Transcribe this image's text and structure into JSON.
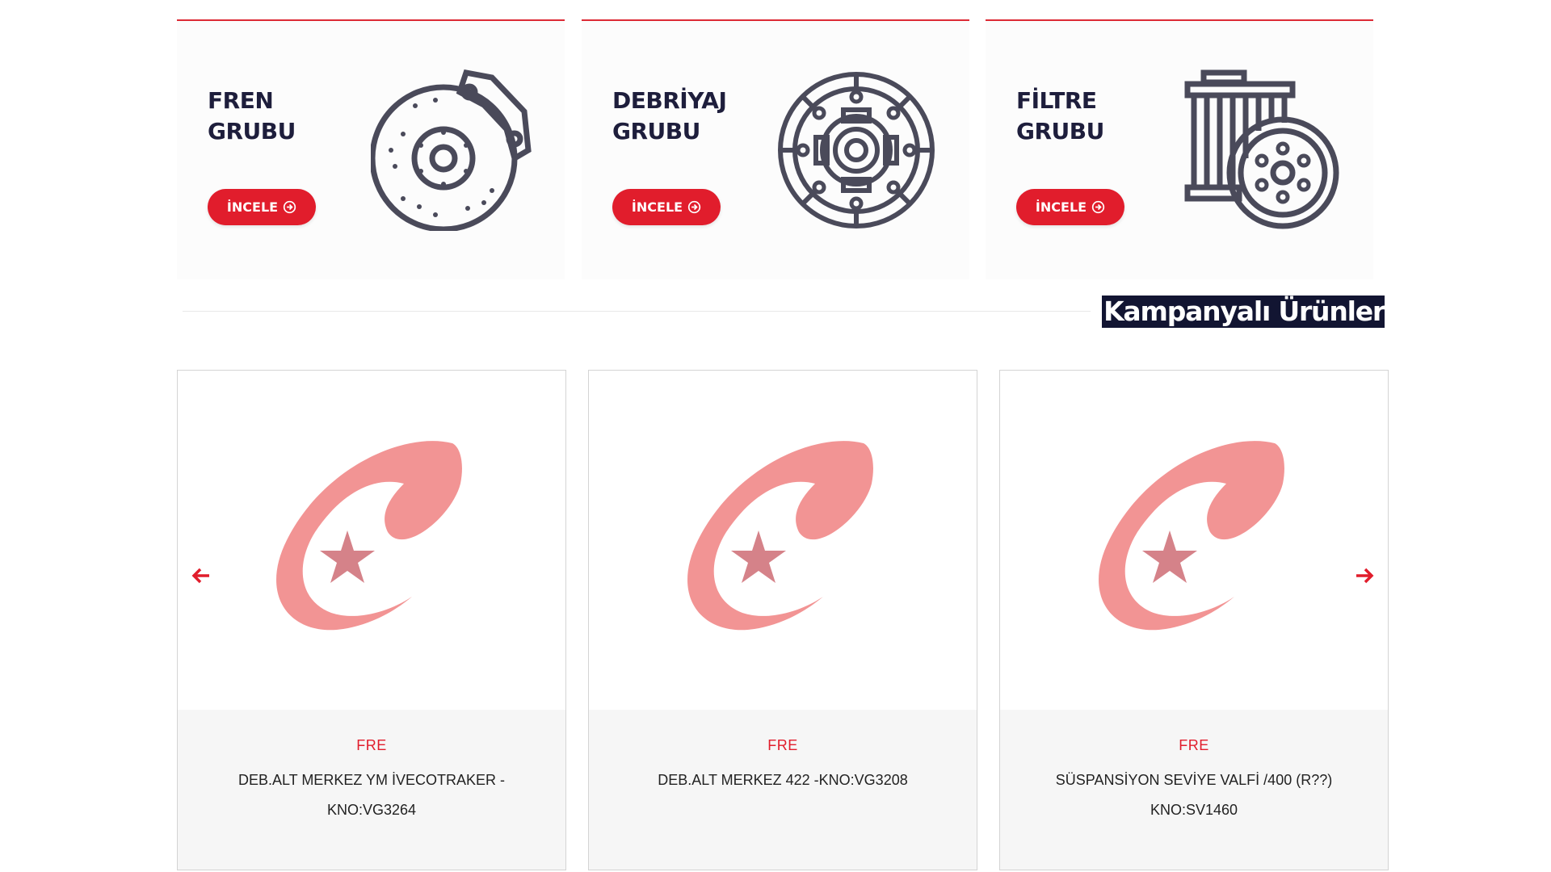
{
  "categories": [
    {
      "title_line1": "FREN",
      "title_line2": "GRUBU",
      "button_label": "İNCELE",
      "icon": "brake-disc-icon"
    },
    {
      "title_line1": "DEBRİYAJ",
      "title_line2": "GRUBU",
      "button_label": "İNCELE",
      "icon": "clutch-disc-icon"
    },
    {
      "title_line1": "FİLTRE",
      "title_line2": "GRUBU",
      "button_label": "İNCELE",
      "icon": "filter-icon"
    }
  ],
  "section": {
    "title": "Kampanyalı Ürünler"
  },
  "products": [
    {
      "brand": "FRE",
      "name": "DEB.ALT MERKEZ YM İVECOTRAKER - KNO:VG3264"
    },
    {
      "brand": "FRE",
      "name": "DEB.ALT MERKEZ 422 -KNO:VG3208"
    },
    {
      "brand": "FRE",
      "name": "SÜSPANSİYON SEVİYE VALFİ /400 (R??) KNO:SV1460"
    }
  ],
  "colors": {
    "accent": "#e11d2c",
    "dark": "#121532",
    "icon": "#4a4a5a",
    "logo": "#f29494",
    "star": "#d58289"
  }
}
